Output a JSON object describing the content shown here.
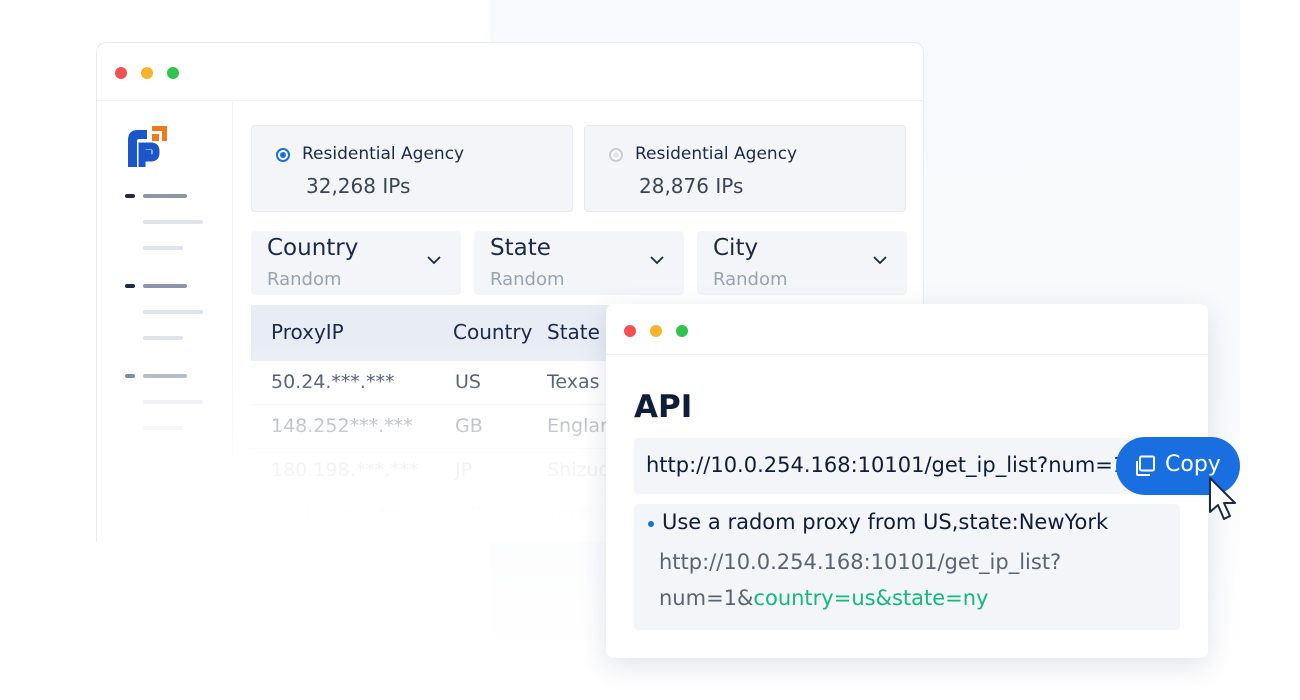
{
  "agencies": [
    {
      "label": "Residential Agency",
      "count": "32,268 IPs",
      "selected": true
    },
    {
      "label": "Residential Agency",
      "count": "28,876 IPs",
      "selected": false
    }
  ],
  "filters": [
    {
      "label": "Country",
      "value": "Random"
    },
    {
      "label": "State",
      "value": "Random"
    },
    {
      "label": "City",
      "value": "Random"
    }
  ],
  "table": {
    "headers": [
      "ProxyIP",
      "Country",
      "State"
    ],
    "rows": [
      [
        "50.24.***.***",
        "US",
        "Texas"
      ],
      [
        "148.252***.***",
        "GB",
        "Englar"
      ],
      [
        "180.198.***.***",
        "JP",
        "Shizuo"
      ],
      [
        "91.125.***.***",
        "GB",
        "Scotla"
      ]
    ]
  },
  "api": {
    "title": "API",
    "url": "http://10.0.254.168:10101/get_ip_list?num=1",
    "copy_label": "Copy",
    "example_desc": "Use a radom proxy from US,state:NewYork",
    "example_url_line1": "http://10.0.254.168:10101/get_ip_list?",
    "example_url_prefix": "num=1&",
    "example_url_params": "country=us&state=ny"
  },
  "colors": {
    "accent": "#1a6fe0",
    "highlight": "#11b97a",
    "logo_blue": "#1a56c9",
    "logo_orange": "#f07a1a",
    "dot_red": "#f05252",
    "dot_yellow": "#f9b32b",
    "dot_green": "#2ec44d"
  },
  "icons": [
    "logo-icon",
    "radio-selected-icon",
    "radio-unselected-icon",
    "chevron-down-icon",
    "copy-icon",
    "cursor-icon"
  ]
}
